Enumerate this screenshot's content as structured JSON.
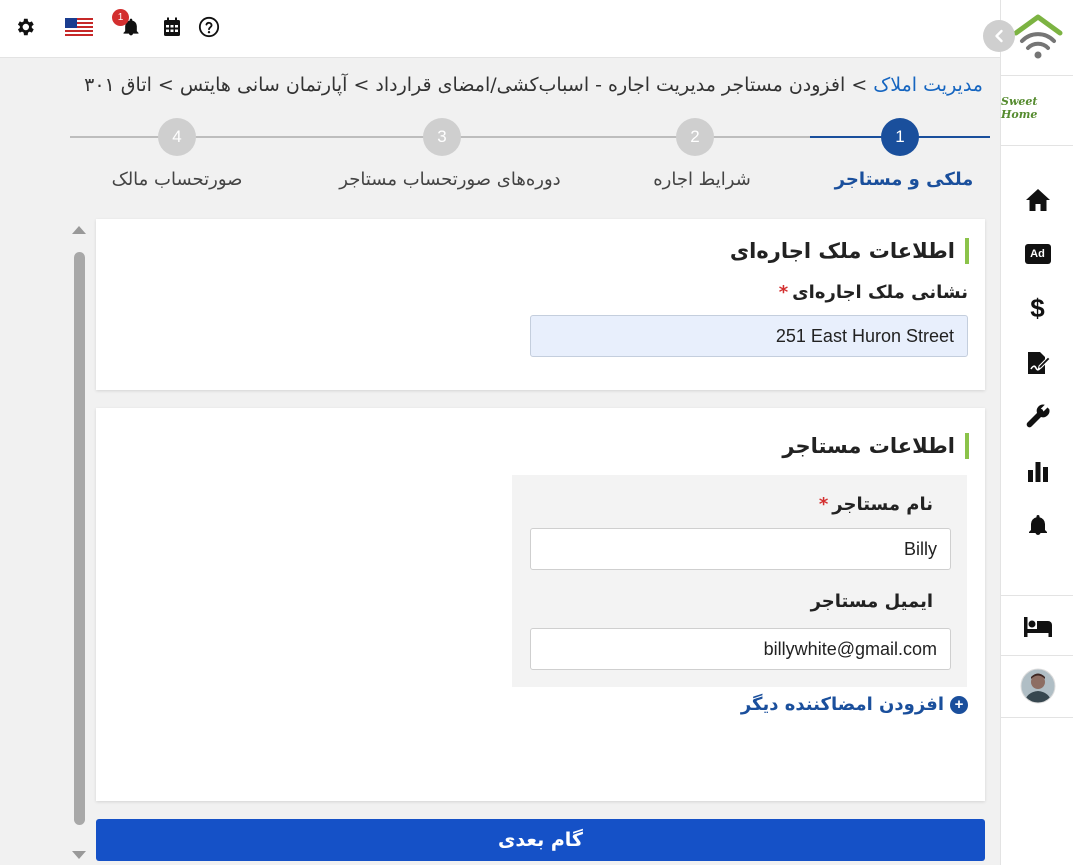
{
  "topbar": {
    "settings_icon": "gear-icon",
    "language_icon": "us-flag-icon",
    "notifications_icon": "bell-icon",
    "notification_count": "1",
    "calendar_icon": "calendar-icon",
    "help_icon": "help-icon"
  },
  "sidebar": {
    "logo_text": "Sweet Home",
    "items": [
      {
        "icon": "home-icon"
      },
      {
        "icon": "ad-icon",
        "label": "Ad"
      },
      {
        "icon": "dollar-icon",
        "label": "$"
      },
      {
        "icon": "contract-sign-icon"
      },
      {
        "icon": "wrench-icon"
      },
      {
        "icon": "bar-chart-icon"
      },
      {
        "icon": "bell-icon"
      },
      {
        "icon": "bed-icon"
      },
      {
        "icon": "user-avatar"
      }
    ]
  },
  "breadcrumb": {
    "root": "مدیریت املاک",
    "sep1": " > ",
    "current": "افزودن مستاجر مدیریت اجاره - اسباب‌کشی/امضای قرارداد",
    "sep2": " > ",
    "property": "آپارتمان سانی هایتس",
    "sep3": " > ",
    "room": "اتاق ۳۰۱"
  },
  "stepper": {
    "steps": [
      {
        "number": "1",
        "label": "ملکی و مستاجر",
        "active": true
      },
      {
        "number": "2",
        "label": "شرایط اجاره",
        "active": false
      },
      {
        "number": "3",
        "label": "دوره‌های صورتحساب مستاجر",
        "active": false
      },
      {
        "number": "4",
        "label": "صورتحساب مالک",
        "active": false
      }
    ]
  },
  "property_card": {
    "title": "اطلاعات ملک اجاره‌ای",
    "address_label": "نشانی ملک اجاره‌ای",
    "required_mark": "*",
    "address_value": "251 East Huron Street"
  },
  "tenant_card": {
    "title": "اطلاعات مستاجر",
    "name_label": "نام مستاجر",
    "required_mark": "*",
    "name_value": "Billy",
    "email_label": "ایمیل مستاجر",
    "email_value": "billywhite@gmail.com",
    "add_signer_label": "افزودن امضاکننده دیگر"
  },
  "actions": {
    "next_label": "گام بعدی"
  },
  "colors": {
    "primary": "#1551c7",
    "step_active": "#1a4f9c",
    "accent_green": "#8bc34a",
    "required": "#d32f2f"
  }
}
